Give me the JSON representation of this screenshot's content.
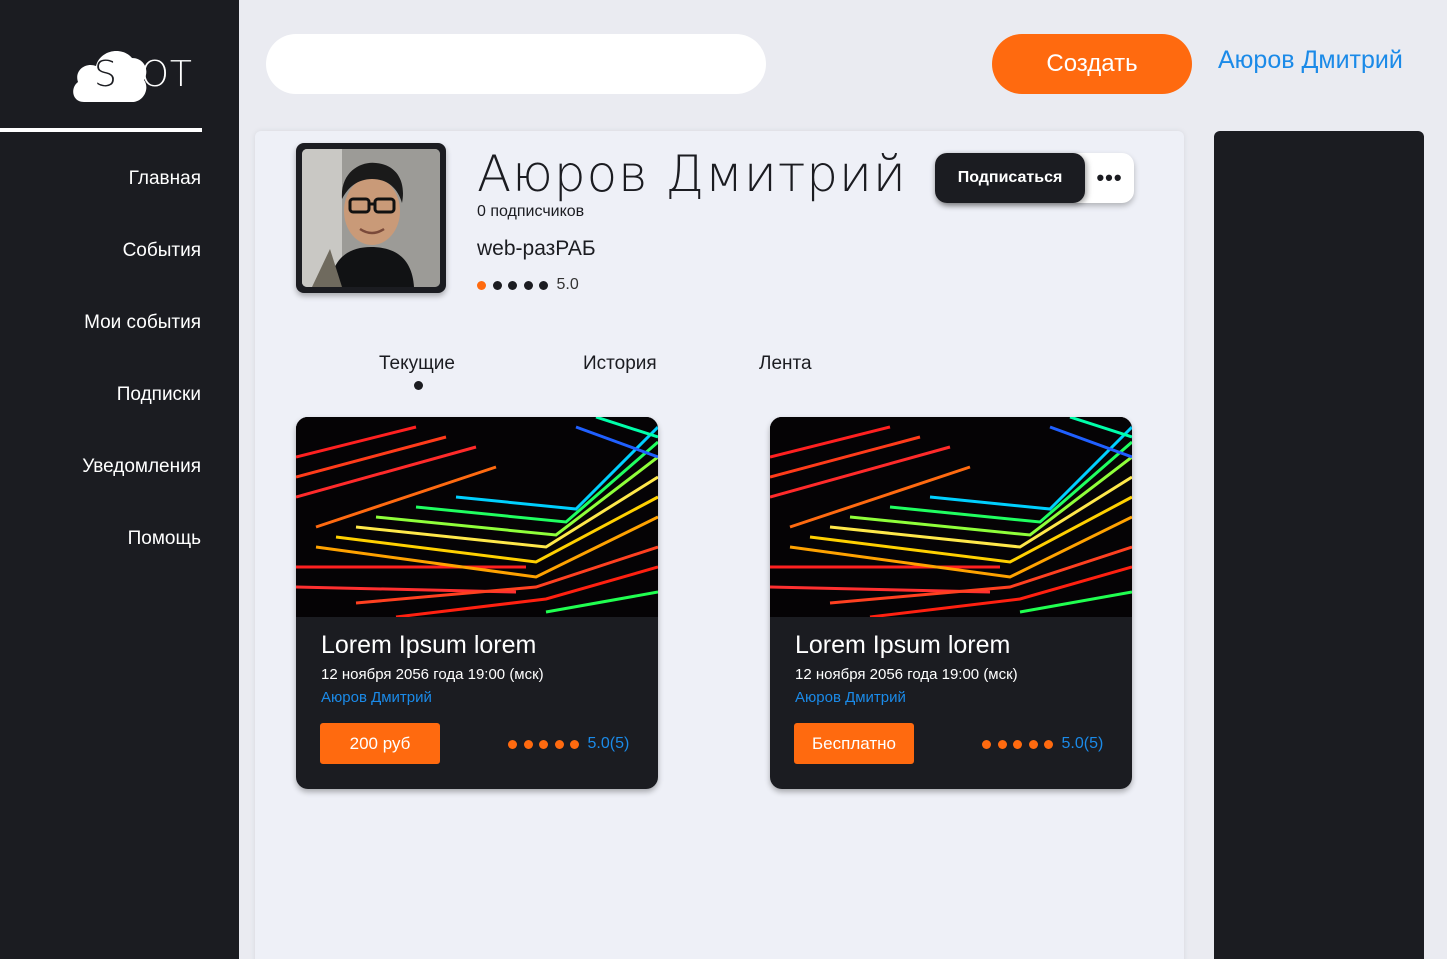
{
  "app": {
    "logo_text_a": "S",
    "logo_text_b": "POT"
  },
  "sidebar": {
    "items": [
      {
        "label": "Главная"
      },
      {
        "label": "События"
      },
      {
        "label": "Мои события"
      },
      {
        "label": "Подписки"
      },
      {
        "label": "Уведомления"
      },
      {
        "label": "Помощь"
      }
    ]
  },
  "header": {
    "search_value": "",
    "create_label": "Создать",
    "user_name": "Аюров Дмитрий"
  },
  "profile": {
    "name": "Аюров Дмитрий",
    "followers": "0 подписчиков",
    "profession": "web-разРАБ",
    "rating": "5.0",
    "subscribe_label": "Подписаться",
    "more_label": "•••"
  },
  "tabs": [
    {
      "label": "Текущие",
      "active": true
    },
    {
      "label": "История",
      "active": false
    },
    {
      "label": "Лента",
      "active": false
    }
  ],
  "events": [
    {
      "title": "Lorem Ipsum lorem",
      "date": "12 ноября 2056 года 19:00 (мск)",
      "author": "Аюров Дмитрий",
      "price": "200 руб",
      "rating": "5.0",
      "rating_count": "(5)"
    },
    {
      "title": "Lorem Ipsum lorem",
      "date": "12 ноября 2056 года 19:00 (мск)",
      "author": "Аюров Дмитрий",
      "price": "Бесплатно",
      "rating": "5.0",
      "rating_count": "(5)"
    }
  ],
  "colors": {
    "accent": "#ff6a0f",
    "dark": "#1b1c21",
    "link": "#1b8ae8",
    "background": "#eaebf1"
  },
  "icons": {
    "more": "more-dots-icon",
    "rating_dot": "rating-dot-icon"
  }
}
